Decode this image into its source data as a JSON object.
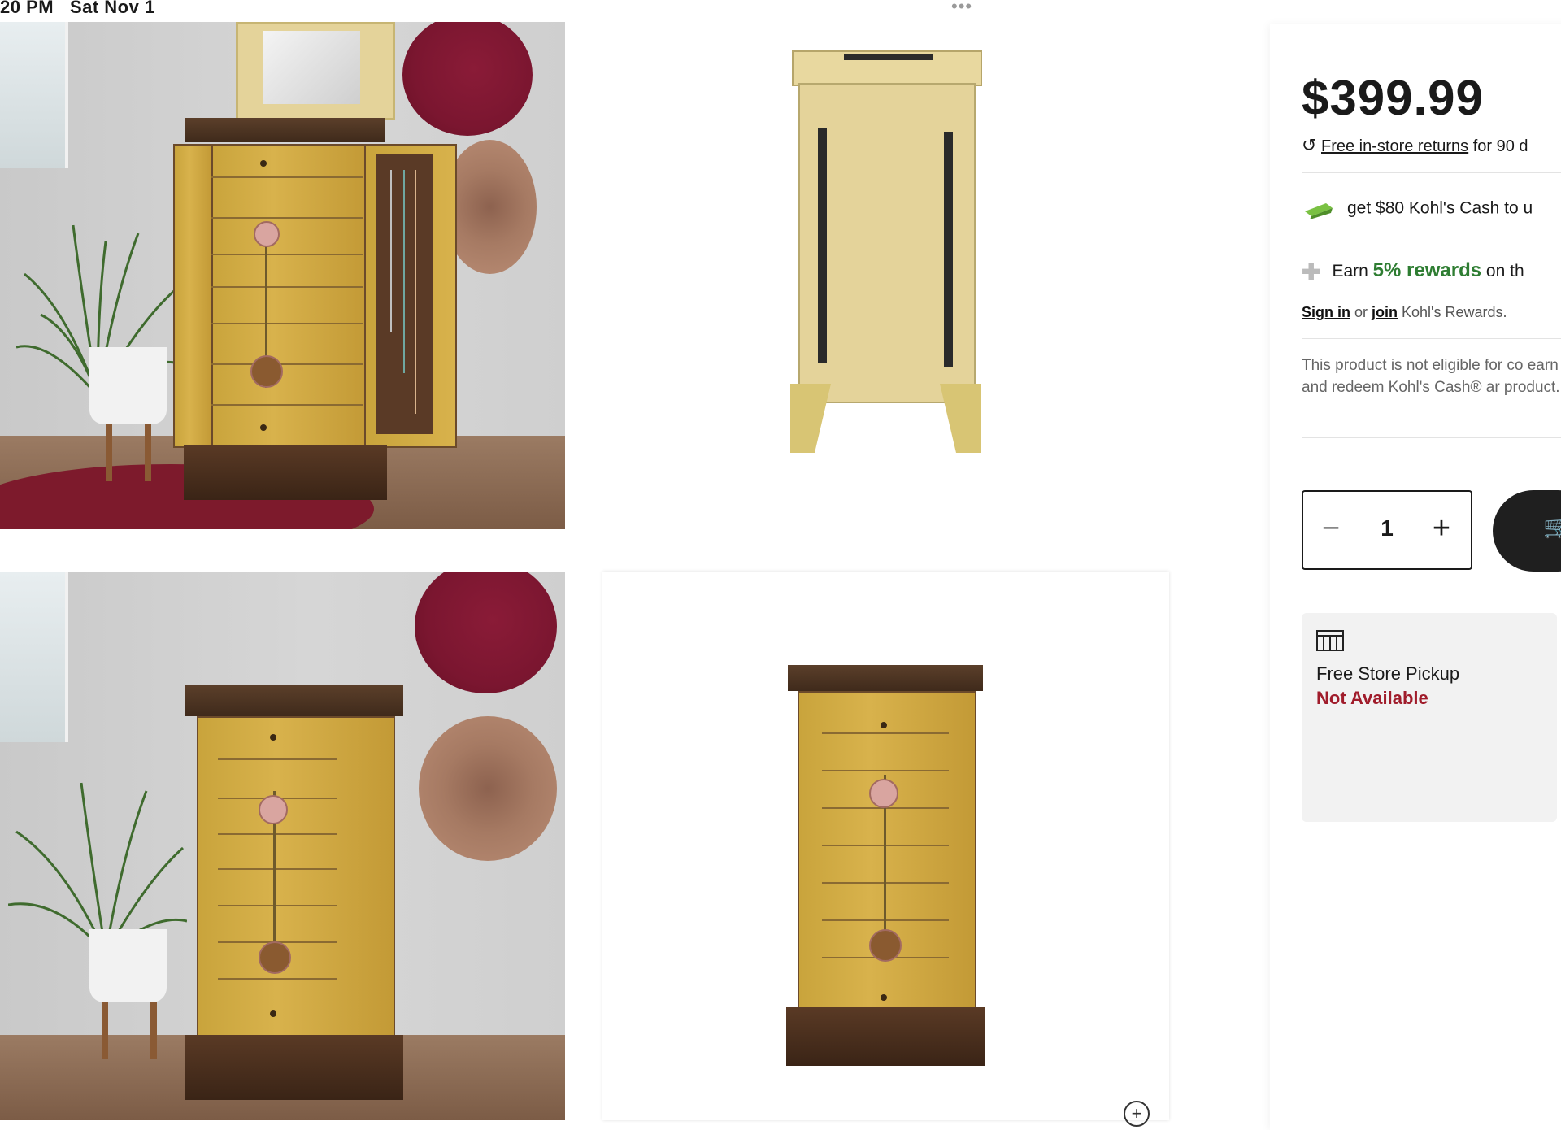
{
  "status_bar": {
    "time": "20 PM",
    "date": "Sat Nov 1",
    "more_icon": "more-dots-icon"
  },
  "gallery": {
    "images": [
      {
        "name": "armoire-open-room"
      },
      {
        "name": "armoire-back"
      },
      {
        "name": "armoire-closed-room"
      },
      {
        "name": "armoire-front-white"
      }
    ],
    "zoom_icon": "zoom-plus-icon"
  },
  "buybox": {
    "price": "$399.99",
    "returns_link": "Free in-store returns",
    "returns_suffix": " for 90 d",
    "kohls_cash_text": "get $80 Kohl's Cash to u",
    "rewards_prefix": "Earn ",
    "rewards_pct": "5% rewards",
    "rewards_suffix": " on th",
    "sign_in": "Sign in",
    "or_text": " or ",
    "join": "join",
    "rewards_suffix2": " Kohl's Rewards.",
    "ineligible_text": "This product is not eligible for co earn and redeem Kohl's Cash® ar product.",
    "quantity": "1",
    "minus_label": "−",
    "plus_label": "+",
    "pickup_title": "Free Store Pickup",
    "pickup_status": "Not Available",
    "colors": {
      "rewards_green": "#2e7d32",
      "unavailable_red": "#a01c2b",
      "cart_button": "#1f1f1f"
    }
  }
}
